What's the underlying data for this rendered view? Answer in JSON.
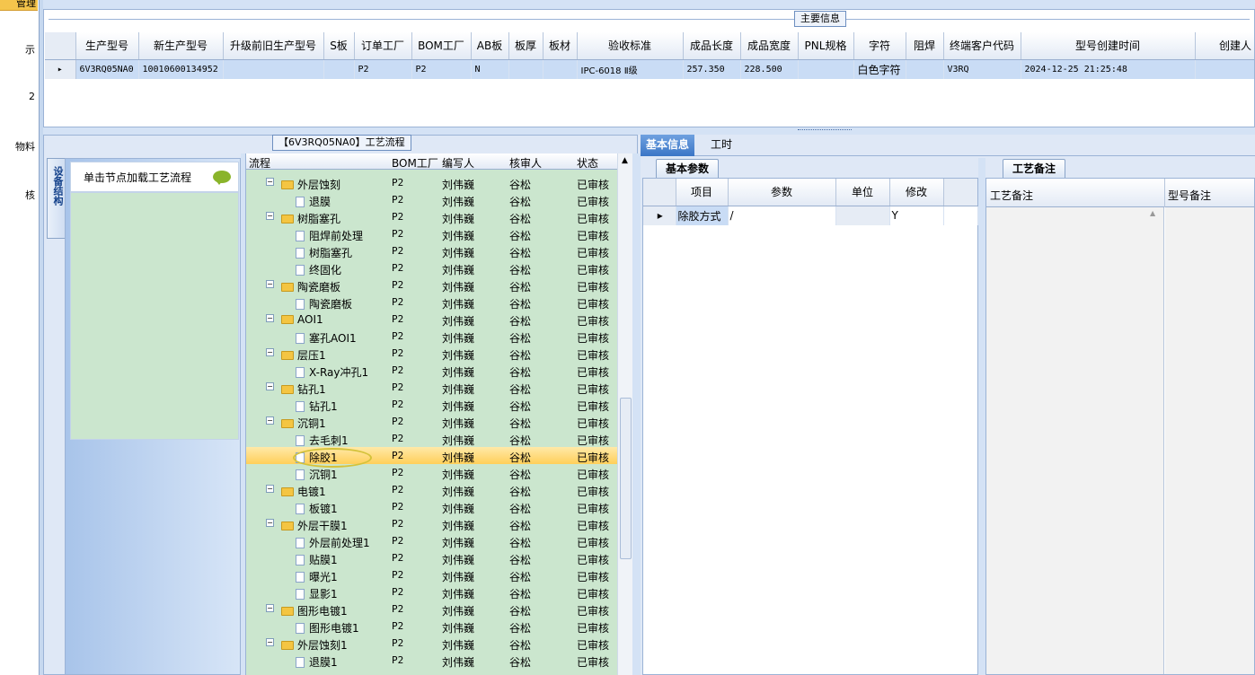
{
  "left_nav": {
    "selected_label": "管理",
    "items": [
      "示",
      "2",
      "物料",
      "核"
    ]
  },
  "main_info": {
    "group_title": "主要信息",
    "columns": [
      "生产型号",
      "新生产型号",
      "升级前旧生产型号",
      "S板",
      "订单工厂",
      "BOM工厂",
      "AB板",
      "板厚",
      "板材",
      "验收标准",
      "成品长度",
      "成品宽度",
      "PNL规格",
      "字符",
      "阻焊",
      "终端客户代码",
      "型号创建时间",
      "创建人"
    ],
    "row": [
      "6V3RQ05NA0",
      "10010600134952",
      "",
      "",
      "P2",
      "P2",
      "N",
      "",
      "",
      "IPC-6018 Ⅱ级",
      "257.350",
      "228.500",
      "",
      "白色字符",
      "",
      "V3RQ",
      "2024-12-25 21:25:48",
      ""
    ]
  },
  "process": {
    "group_title": "【6V3RQ05NA0】工艺流程",
    "side_tab": "设备结构",
    "hint": "单击节点加载工艺流程",
    "columns": [
      "流程",
      "BOM工厂",
      "编写人",
      "核审人",
      "状态"
    ],
    "rows": [
      {
        "name": "外层蚀刻",
        "level": 0,
        "factory": "P2",
        "writer": "刘伟巍",
        "reviewer": "谷松",
        "status": "已审核"
      },
      {
        "name": "退膜",
        "level": 1,
        "factory": "P2",
        "writer": "刘伟巍",
        "reviewer": "谷松",
        "status": "已审核"
      },
      {
        "name": "树脂塞孔",
        "level": 0,
        "factory": "P2",
        "writer": "刘伟巍",
        "reviewer": "谷松",
        "status": "已审核"
      },
      {
        "name": "阻焊前处理",
        "level": 1,
        "factory": "P2",
        "writer": "刘伟巍",
        "reviewer": "谷松",
        "status": "已审核"
      },
      {
        "name": "树脂塞孔",
        "level": 1,
        "factory": "P2",
        "writer": "刘伟巍",
        "reviewer": "谷松",
        "status": "已审核"
      },
      {
        "name": "终固化",
        "level": 1,
        "factory": "P2",
        "writer": "刘伟巍",
        "reviewer": "谷松",
        "status": "已审核"
      },
      {
        "name": "陶瓷磨板",
        "level": 0,
        "factory": "P2",
        "writer": "刘伟巍",
        "reviewer": "谷松",
        "status": "已审核"
      },
      {
        "name": "陶瓷磨板",
        "level": 1,
        "factory": "P2",
        "writer": "刘伟巍",
        "reviewer": "谷松",
        "status": "已审核"
      },
      {
        "name": "AOI1",
        "level": 0,
        "factory": "P2",
        "writer": "刘伟巍",
        "reviewer": "谷松",
        "status": "已审核"
      },
      {
        "name": "塞孔AOI1",
        "level": 1,
        "factory": "P2",
        "writer": "刘伟巍",
        "reviewer": "谷松",
        "status": "已审核"
      },
      {
        "name": "层压1",
        "level": 0,
        "factory": "P2",
        "writer": "刘伟巍",
        "reviewer": "谷松",
        "status": "已审核"
      },
      {
        "name": "X-Ray冲孔1",
        "level": 1,
        "factory": "P2",
        "writer": "刘伟巍",
        "reviewer": "谷松",
        "status": "已审核"
      },
      {
        "name": "钻孔1",
        "level": 0,
        "factory": "P2",
        "writer": "刘伟巍",
        "reviewer": "谷松",
        "status": "已审核"
      },
      {
        "name": "钻孔1",
        "level": 1,
        "factory": "P2",
        "writer": "刘伟巍",
        "reviewer": "谷松",
        "status": "已审核"
      },
      {
        "name": "沉铜1",
        "level": 0,
        "factory": "P2",
        "writer": "刘伟巍",
        "reviewer": "谷松",
        "status": "已审核"
      },
      {
        "name": "去毛刺1",
        "level": 1,
        "factory": "P2",
        "writer": "刘伟巍",
        "reviewer": "谷松",
        "status": "已审核"
      },
      {
        "name": "除胶1",
        "level": 1,
        "factory": "P2",
        "writer": "刘伟巍",
        "reviewer": "谷松",
        "status": "已审核",
        "selected": true
      },
      {
        "name": "沉铜1",
        "level": 1,
        "factory": "P2",
        "writer": "刘伟巍",
        "reviewer": "谷松",
        "status": "已审核"
      },
      {
        "name": "电镀1",
        "level": 0,
        "factory": "P2",
        "writer": "刘伟巍",
        "reviewer": "谷松",
        "status": "已审核"
      },
      {
        "name": "板镀1",
        "level": 1,
        "factory": "P2",
        "writer": "刘伟巍",
        "reviewer": "谷松",
        "status": "已审核"
      },
      {
        "name": "外层干膜1",
        "level": 0,
        "factory": "P2",
        "writer": "刘伟巍",
        "reviewer": "谷松",
        "status": "已审核"
      },
      {
        "name": "外层前处理1",
        "level": 1,
        "factory": "P2",
        "writer": "刘伟巍",
        "reviewer": "谷松",
        "status": "已审核"
      },
      {
        "name": "贴膜1",
        "level": 1,
        "factory": "P2",
        "writer": "刘伟巍",
        "reviewer": "谷松",
        "status": "已审核"
      },
      {
        "name": "曝光1",
        "level": 1,
        "factory": "P2",
        "writer": "刘伟巍",
        "reviewer": "谷松",
        "status": "已审核"
      },
      {
        "name": "显影1",
        "level": 1,
        "factory": "P2",
        "writer": "刘伟巍",
        "reviewer": "谷松",
        "status": "已审核"
      },
      {
        "name": "图形电镀1",
        "level": 0,
        "factory": "P2",
        "writer": "刘伟巍",
        "reviewer": "谷松",
        "status": "已审核"
      },
      {
        "name": "图形电镀1",
        "level": 1,
        "factory": "P2",
        "writer": "刘伟巍",
        "reviewer": "谷松",
        "status": "已审核"
      },
      {
        "name": "外层蚀刻1",
        "level": 0,
        "factory": "P2",
        "writer": "刘伟巍",
        "reviewer": "谷松",
        "status": "已审核"
      },
      {
        "name": "退膜1",
        "level": 1,
        "factory": "P2",
        "writer": "刘伟巍",
        "reviewer": "谷松",
        "status": "已审核"
      }
    ]
  },
  "detail": {
    "tabs": [
      "基本信息",
      "工时"
    ],
    "param_tab": "基本参数",
    "param_columns": [
      "项目",
      "参数",
      "单位",
      "修改"
    ],
    "param_row": [
      "除胶方式",
      "/",
      "",
      "Y"
    ],
    "notes_tab": "工艺备注",
    "notes_columns": [
      "工艺备注",
      "型号备注"
    ]
  }
}
